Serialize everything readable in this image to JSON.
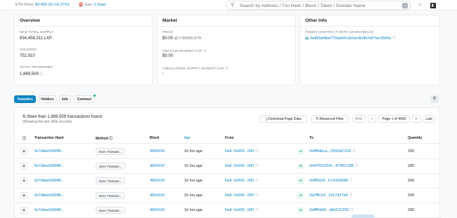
{
  "topbar": {
    "eth_price_label": "ETH Price:",
    "eth_price_value": "$3,455.20 (+0.27%)",
    "gas_label": "Gas:",
    "gas_value": "1 Gwei",
    "search_placeholder": "Search by Address / Txn Hash / Block / Token / Domain Name",
    "search_shortcut": "/"
  },
  "overview": {
    "title": "Overview",
    "max_supply_label": "MAX TOTAL SUPPLY",
    "max_supply_value": "834,458,311 LXP",
    "holders_label": "HOLDERS",
    "holders_value": "752,910",
    "transfers_label": "TOTAL TRANSFERS",
    "transfers_value": "1,869,509"
  },
  "market": {
    "title": "Market",
    "price_label": "PRICE",
    "price_value": "$0.00",
    "price_sub": "@ 0.000000 ETH",
    "onchain_cap_label": "ONCHAIN MARKET CAP",
    "onchain_cap_value": "$0.00",
    "circ_cap_label": "CIRCULATING SUPPLY MARKET CAP",
    "circ_cap_value": "-"
  },
  "other_info": {
    "title": "Other Info",
    "contract_label": "TOKEN CONTRACT (WITH 18 DECIMALS)",
    "contract_value": "0xd83af4fbd77f3ab65c3b1dc4b3fd7e67aecf599a"
  },
  "tabs": [
    "Transfers",
    "Holders",
    "Info",
    "Contract"
  ],
  "table": {
    "summary": "More than 1,869,509 transactions found",
    "summary_sub": "(Showing the last 100k records)",
    "download_label": "Download Page Data",
    "filter_label": "Advanced Filter",
    "first_label": "First",
    "prev_label": "<",
    "page_label": "Page 1 of 4000",
    "next_label": ">",
    "last_label": "Last",
    "headers": {
      "hash": "Transaction Hash",
      "method": "Method",
      "block": "Block",
      "age": "Age",
      "from": "From",
      "to": "To",
      "quantity": "Quantity"
    },
    "rows": [
      {
        "hash": "0x7ddee9284f6...",
        "method": "Exec Transact...",
        "block": "4954150",
        "age": "16 hrs ago",
        "from": "Null: 0x000...000",
        "to": "0xfff94bca...2592AC229",
        "quantity": "200"
      },
      {
        "hash": "0x7ddee9284f6...",
        "method": "Exec Transact...",
        "block": "4954150",
        "age": "16 hrs ago",
        "from": "Null: 0x000...000",
        "to": "0xFFFFD250...47381c3f8",
        "quantity": "200"
      },
      {
        "hash": "0x7ddee9284f6...",
        "method": "Exec Transact...",
        "block": "4954150",
        "age": "16 hrs ago",
        "from": "Null: 0x000...000",
        "to": "0xfff91b8...F14100948",
        "quantity": "200"
      },
      {
        "hash": "0x7ddee9284f6...",
        "method": "Exec Transact...",
        "block": "4954150",
        "age": "16 hrs ago",
        "from": "Null: 0x000...000",
        "to": "0xFfffc23...1017d27d4",
        "quantity": "200"
      },
      {
        "hash": "0x7ddee9284f6...",
        "method": "Exec Transact...",
        "block": "4954150",
        "age": "16 hrs ago",
        "from": "Null: 0x000...000",
        "to": "0xffff6b99...db6CCf783",
        "quantity": "200"
      }
    ]
  }
}
